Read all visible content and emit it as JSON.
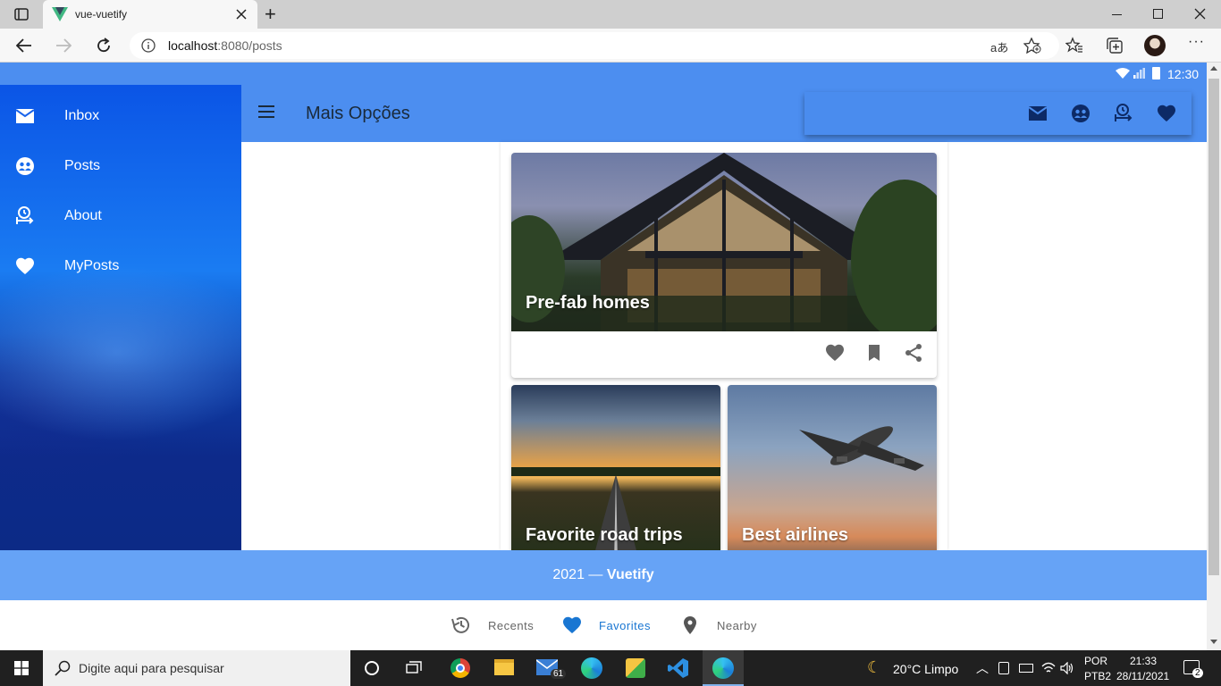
{
  "browser": {
    "tab_title": "vue-vuetify",
    "url_host": "localhost",
    "url_rest": ":8080/posts",
    "new_tab": "+",
    "aa_label": "aあ",
    "menu": "···"
  },
  "status": {
    "time": "12:30"
  },
  "drawer": {
    "items": [
      {
        "label": "Inbox",
        "icon": "mail-icon"
      },
      {
        "label": "Posts",
        "icon": "people-icon"
      },
      {
        "label": "About",
        "icon": "user-clock-icon"
      },
      {
        "label": "MyPosts",
        "icon": "heart-icon"
      }
    ]
  },
  "appbar": {
    "title": "Mais Opções"
  },
  "cards": [
    {
      "title": "Pre-fab homes"
    },
    {
      "title": "Favorite road trips"
    },
    {
      "title": "Best airlines"
    }
  ],
  "footer": {
    "year": "2021 — ",
    "brand": "Vuetify"
  },
  "bottom_nav": [
    {
      "label": "Recents",
      "icon": "history-icon"
    },
    {
      "label": "Favorites",
      "icon": "heart-icon"
    },
    {
      "label": "Nearby",
      "icon": "map-marker-icon"
    }
  ],
  "taskbar": {
    "search_placeholder": "Digite aqui para pesquisar",
    "mail_badge": "61",
    "weather": "20°C  Limpo",
    "lang_top": "POR",
    "lang_bottom": "PTB2",
    "time": "21:33",
    "date": "28/11/2021",
    "notif_count": "2"
  },
  "colors": {
    "primary": "#4c8ef0",
    "footer": "#66a3f6",
    "active_nav": "#1976d2"
  }
}
